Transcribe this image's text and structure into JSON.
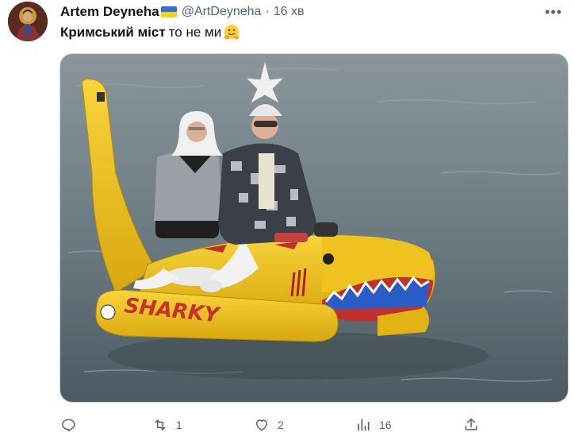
{
  "author": {
    "display_name": "Artem Deyneha",
    "handle": "@ArtDeyneha",
    "separator": "·",
    "time": "16 хв",
    "flag_icon": "ukraine-flag-icon",
    "avatar_icon": "icon-portrait-avatar"
  },
  "tweet": {
    "text_bold": "Кримський міст",
    "text_plain": "то не ми",
    "emoji_icon": "hugging-face-emoji"
  },
  "media": {
    "description_icon": "photo-yellow-shark-inflatable-boat",
    "boat_lettering": "SHARKY"
  },
  "actions": {
    "reply": {
      "icon": "reply-icon",
      "count": ""
    },
    "retweet": {
      "icon": "retweet-icon",
      "count": "1"
    },
    "like": {
      "icon": "heart-icon",
      "count": "2"
    },
    "views": {
      "icon": "views-icon",
      "count": "16"
    },
    "share": {
      "icon": "share-icon",
      "count": ""
    }
  },
  "colors": {
    "text_primary": "#0f1419",
    "text_secondary": "#536471",
    "border": "#cfd9de",
    "water": "#6f7d86",
    "boat_yellow": "#f2c21a"
  }
}
